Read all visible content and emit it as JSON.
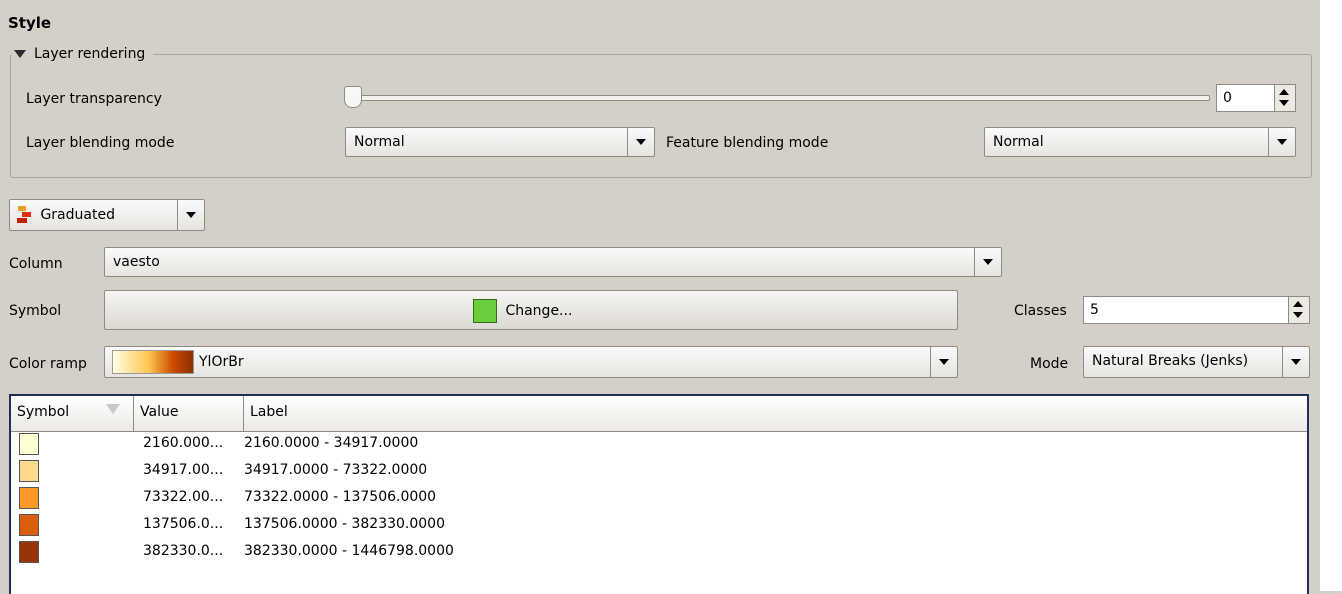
{
  "section_title": "Style",
  "layer_rendering": {
    "title": "Layer rendering",
    "transparency_label": "Layer transparency",
    "transparency_value": "0",
    "transparency_level": 0,
    "layer_blending_label": "Layer blending mode",
    "layer_blending_value": "Normal",
    "feature_blending_label": "Feature blending mode",
    "feature_blending_value": "Normal"
  },
  "renderer": {
    "type": "Graduated"
  },
  "column": {
    "label": "Column",
    "value": "vaesto"
  },
  "symbol": {
    "label": "Symbol",
    "button_label": "Change...",
    "swatch_color": "#6acd3c"
  },
  "classes": {
    "label": "Classes",
    "value": "5"
  },
  "color_ramp": {
    "label": "Color ramp",
    "value": "YlOrBr"
  },
  "mode": {
    "label": "Mode",
    "value": "Natural Breaks (Jenks)"
  },
  "table": {
    "headers": [
      "Symbol",
      "Value",
      "Label"
    ],
    "rows": [
      {
        "color": "#ffffd4",
        "value": "2160.000...",
        "label": "2160.0000 - 34917.0000"
      },
      {
        "color": "#fed98e",
        "value": "34917.00...",
        "label": "34917.0000 - 73322.0000"
      },
      {
        "color": "#fe9929",
        "value": "73322.00...",
        "label": "73322.0000 - 137506.0000"
      },
      {
        "color": "#d95f0e",
        "value": "137506.0...",
        "label": "137506.0000 - 382330.0000"
      },
      {
        "color": "#993404",
        "value": "382330.0...",
        "label": "382330.0000 - 1446798.0000"
      }
    ]
  }
}
